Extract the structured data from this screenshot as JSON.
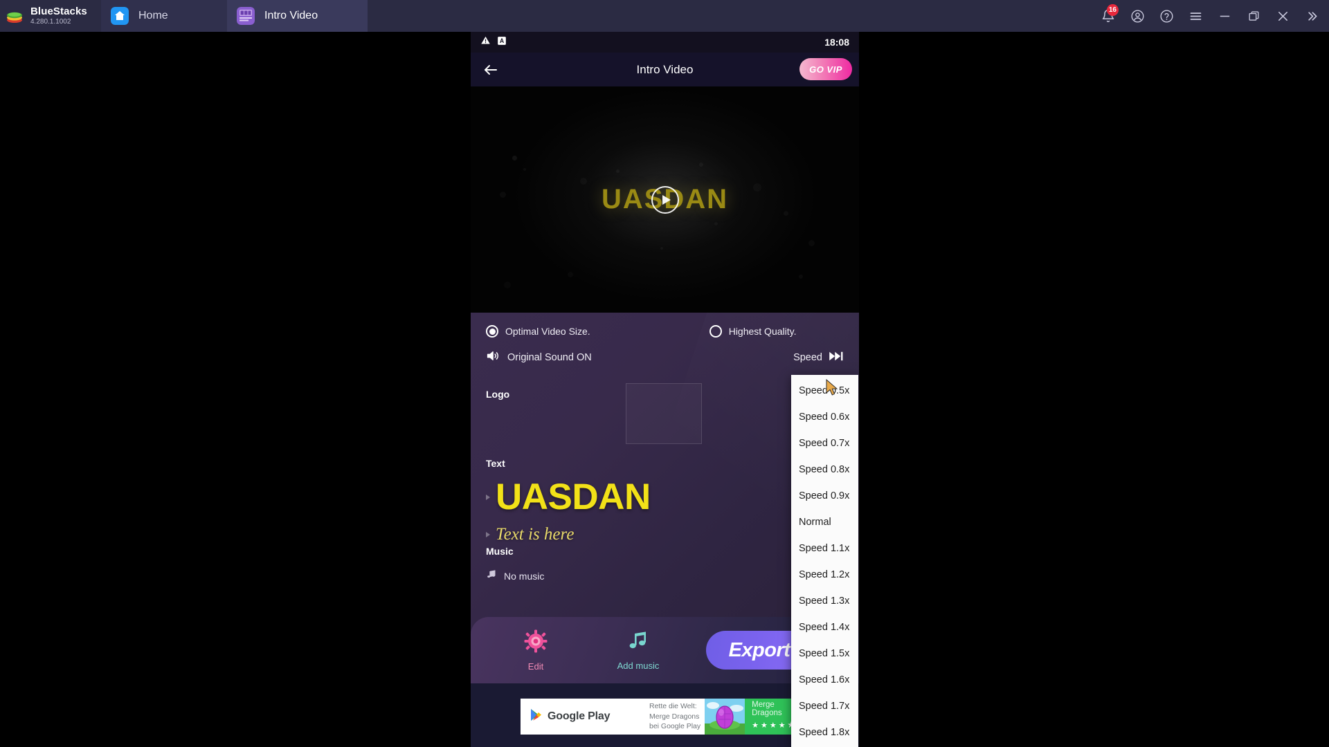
{
  "window": {
    "brand": "BlueStacks",
    "version": "4.280.1.1002",
    "tabs": [
      {
        "label": "Home",
        "icon": "home-icon",
        "active": false
      },
      {
        "label": "Intro Video",
        "icon": "intro-video-app-icon",
        "active": true
      }
    ],
    "controls": [
      {
        "name": "notifications-icon",
        "badge": "16"
      },
      {
        "name": "account-icon"
      },
      {
        "name": "help-icon"
      },
      {
        "name": "menu-icon"
      },
      {
        "name": "minimize-icon"
      },
      {
        "name": "maximize-icon"
      },
      {
        "name": "close-icon"
      },
      {
        "name": "chevron-double-right-icon"
      }
    ]
  },
  "android": {
    "statusbar": {
      "time": "18:08",
      "icons": [
        "warning-icon",
        "a-letter-icon"
      ]
    },
    "appbar": {
      "title": "Intro Video",
      "back": "back-arrow-icon",
      "vip_label": "GO VIP"
    },
    "preview": {
      "text": "UASDAN",
      "play": "play-icon"
    },
    "quality": {
      "option_1": "Optimal Video Size.",
      "option_1_selected": true,
      "option_2": "Highest Quality.",
      "option_2_selected": false
    },
    "sound": {
      "label": "Original Sound ON",
      "icon": "speaker-on-icon"
    },
    "speed": {
      "label": "Speed",
      "icon": "fast-forward-icon"
    },
    "logo": {
      "label": "Logo"
    },
    "text": {
      "label": "Text",
      "line_1": "UASDAN",
      "line_2": "Text is here"
    },
    "music": {
      "label": "Music",
      "value": "No music",
      "icon": "music-note-icon"
    },
    "toolbar": {
      "edit_label": "Edit",
      "edit_icon": "gear-icon",
      "music_label": "Add music",
      "music_icon": "music-note-icon",
      "export_label": "Export"
    },
    "ad": {
      "brand": "Google Play",
      "copy_line_1": "Rette die Welt:",
      "copy_line_2": "Merge Dragons",
      "copy_line_3": "bei Google Play",
      "app_title": "Merge Dragons",
      "stars": "★★★★⯪"
    }
  },
  "speed_dropdown": {
    "items": [
      "Speed 0.5x",
      "Speed 0.6x",
      "Speed 0.7x",
      "Speed 0.8x",
      "Speed 0.9x",
      "Normal",
      "Speed 1.1x",
      "Speed 1.2x",
      "Speed 1.3x",
      "Speed 1.4x",
      "Speed 1.5x",
      "Speed 1.6x",
      "Speed 1.7x",
      "Speed 1.8x"
    ]
  },
  "colors": {
    "titlebar": "#2b2b43",
    "tab_active": "#3a3a5c",
    "accent_yellow": "#f2e118",
    "vip_pink": "#ef2aa2",
    "export_purple": "#7b63ee",
    "badge_red": "#e8283c",
    "ad_green": "#2fc258"
  }
}
